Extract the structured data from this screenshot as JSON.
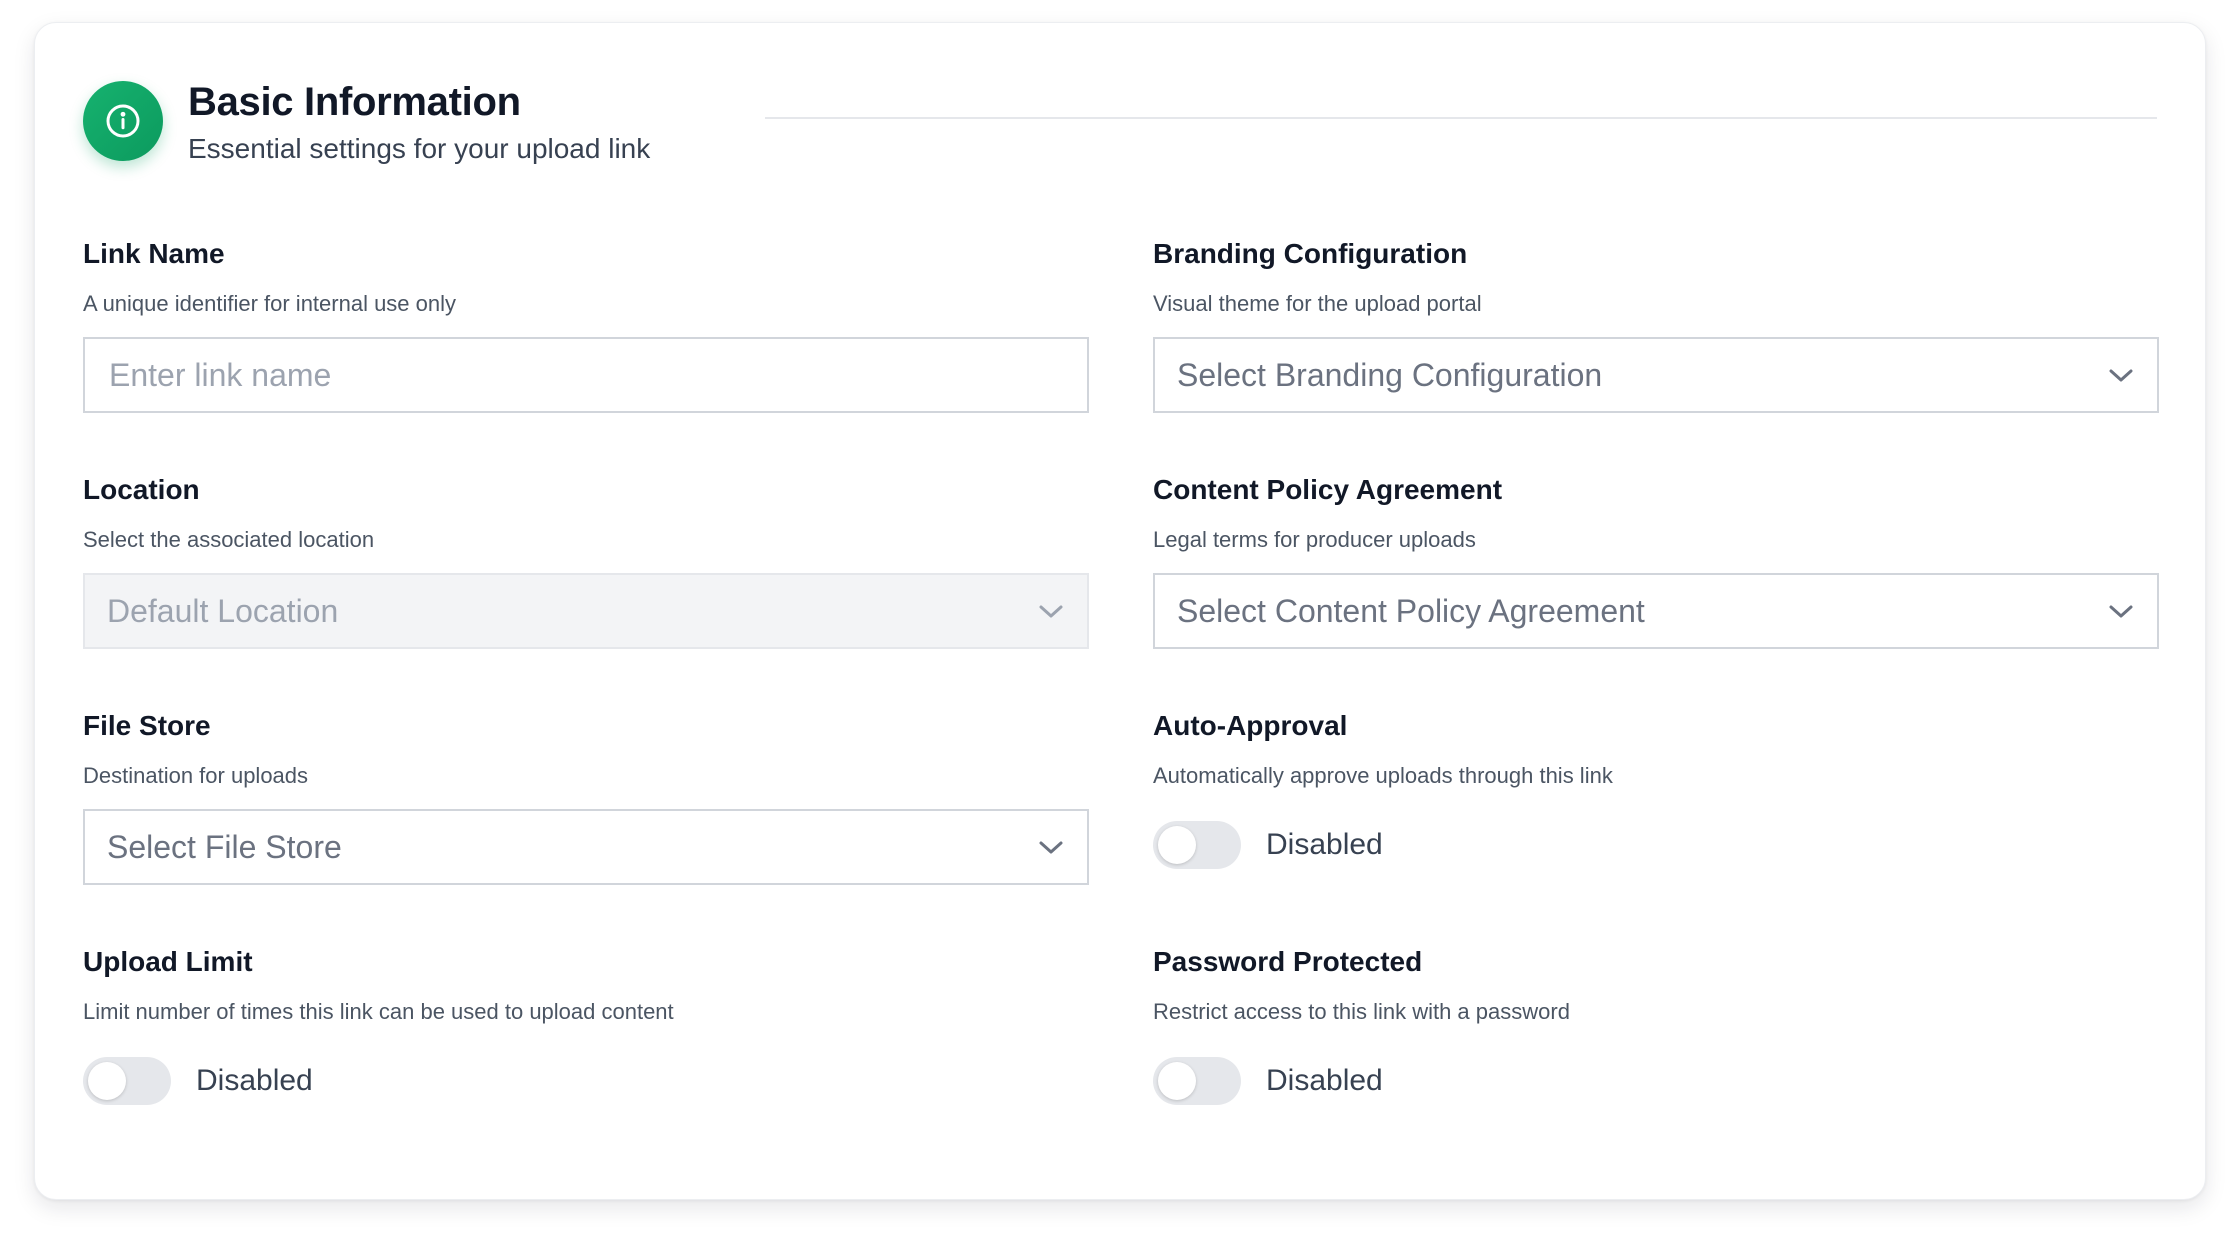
{
  "section": {
    "title": "Basic Information",
    "subtitle": "Essential settings for your upload link",
    "icon": "info-icon",
    "accent_color": "#10a866"
  },
  "fields": {
    "link_name": {
      "label": "Link Name",
      "description": "A unique identifier for internal use only",
      "value": "",
      "placeholder": "Enter link name"
    },
    "branding_configuration": {
      "label": "Branding Configuration",
      "description": "Visual theme for the upload portal",
      "selected": "Select Branding Configuration"
    },
    "location": {
      "label": "Location",
      "description": "Select the associated location",
      "selected": "Default Location",
      "disabled": true
    },
    "content_policy_agreement": {
      "label": "Content Policy Agreement",
      "description": "Legal terms for producer uploads",
      "selected": "Select Content Policy Agreement"
    },
    "file_store": {
      "label": "File Store",
      "description": "Destination for uploads",
      "selected": "Select File Store"
    },
    "auto_approval": {
      "label": "Auto-Approval",
      "description": "Automatically approve uploads through this link",
      "state": "Disabled",
      "enabled": false
    },
    "upload_limit": {
      "label": "Upload Limit",
      "description": "Limit number of times this link can be used to upload content",
      "state": "Disabled",
      "enabled": false
    },
    "password_protected": {
      "label": "Password Protected",
      "description": "Restrict access to this link with a password",
      "state": "Disabled",
      "enabled": false
    }
  }
}
